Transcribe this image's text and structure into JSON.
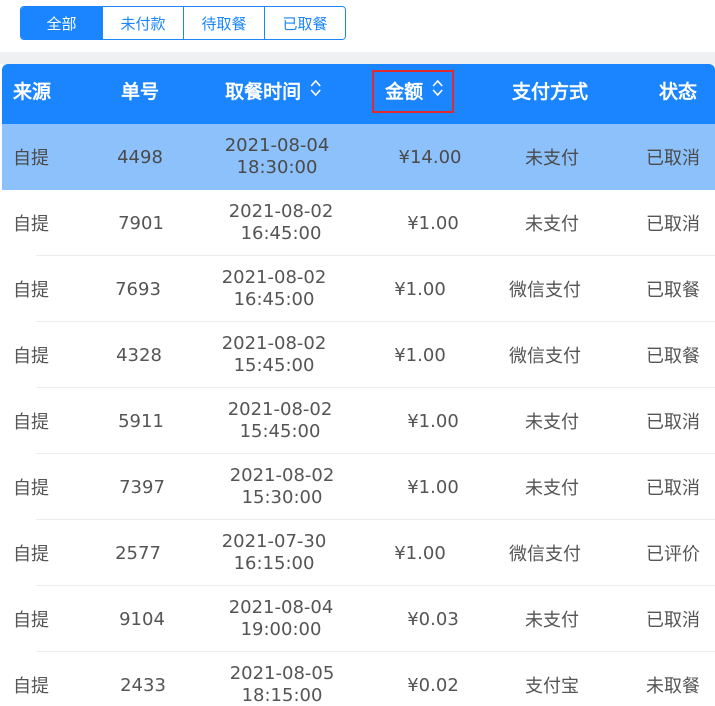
{
  "filter_tabs": [
    {
      "label": "全部",
      "active": true
    },
    {
      "label": "未付款",
      "active": false
    },
    {
      "label": "待取餐",
      "active": false
    },
    {
      "label": "已取餐",
      "active": false
    }
  ],
  "table": {
    "columns": {
      "source": "来源",
      "order_no": "单号",
      "pickup_time": "取餐时间",
      "amount": "金额",
      "payment": "支付方式",
      "status": "状态"
    },
    "sort_icon": "sort-updown-icon",
    "highlight_color": "#e02b2b",
    "header_color": "#1a85ff",
    "selected_row_color": "#8dc1fb",
    "rows": [
      {
        "source": "自提",
        "order_no": "4498",
        "date": "2021-08-04",
        "time": "18:30:00",
        "amount": "¥14.00",
        "payment": "未支付",
        "status": "已取消",
        "selected": true
      },
      {
        "source": "自提",
        "order_no": "7901",
        "date": "2021-08-02",
        "time": "16:45:00",
        "amount": "¥1.00",
        "payment": "未支付",
        "status": "已取消",
        "selected": false
      },
      {
        "source": "自提",
        "order_no": "7693",
        "date": "2021-08-02",
        "time": "16:45:00",
        "amount": "¥1.00",
        "payment": "微信支付",
        "status": "已取餐",
        "selected": false
      },
      {
        "source": "自提",
        "order_no": "4328",
        "date": "2021-08-02",
        "time": "15:45:00",
        "amount": "¥1.00",
        "payment": "微信支付",
        "status": "已取餐",
        "selected": false
      },
      {
        "source": "自提",
        "order_no": "5911",
        "date": "2021-08-02",
        "time": "15:45:00",
        "amount": "¥1.00",
        "payment": "未支付",
        "status": "已取消",
        "selected": false
      },
      {
        "source": "自提",
        "order_no": "7397",
        "date": "2021-08-02",
        "time": "15:30:00",
        "amount": "¥1.00",
        "payment": "未支付",
        "status": "已取消",
        "selected": false
      },
      {
        "source": "自提",
        "order_no": "2577",
        "date": "2021-07-30",
        "time": "16:15:00",
        "amount": "¥1.00",
        "payment": "微信支付",
        "status": "已评价",
        "selected": false
      },
      {
        "source": "自提",
        "order_no": "9104",
        "date": "2021-08-04",
        "time": "19:00:00",
        "amount": "¥0.03",
        "payment": "未支付",
        "status": "已取消",
        "selected": false
      },
      {
        "source": "自提",
        "order_no": "2433",
        "date": "2021-08-05",
        "time": "18:15:00",
        "amount": "¥0.02",
        "payment": "支付宝",
        "status": "未取餐",
        "selected": false
      }
    ]
  }
}
